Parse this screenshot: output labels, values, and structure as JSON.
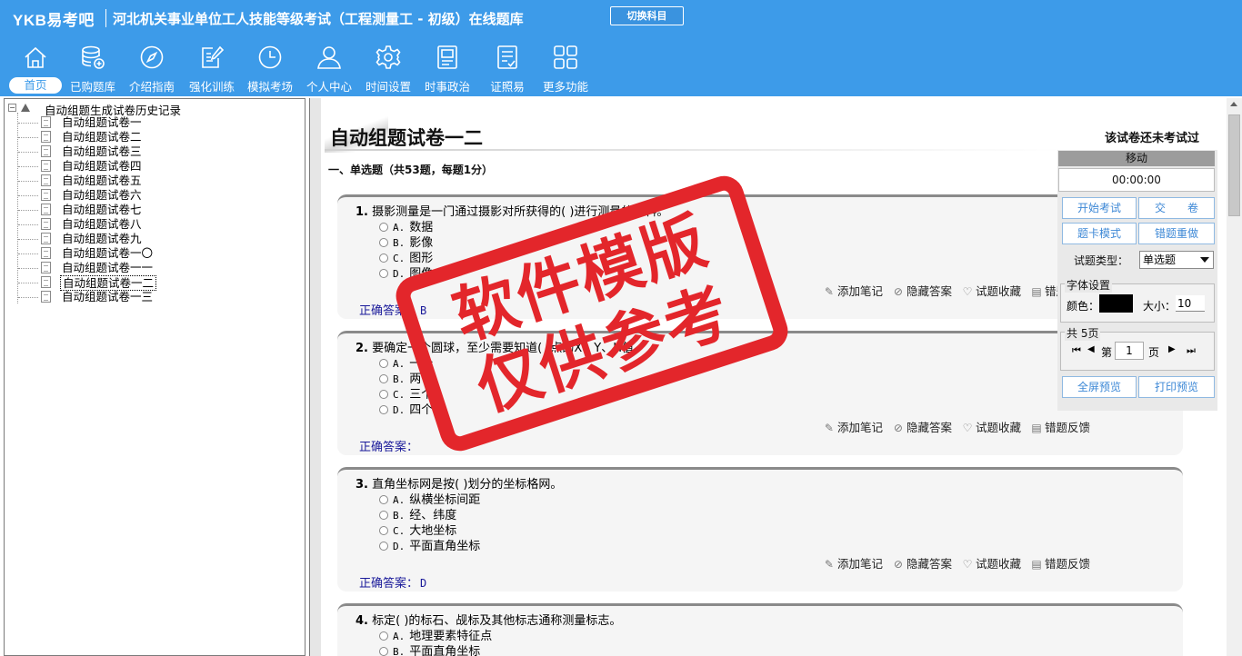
{
  "window": {
    "logo": "YKB易考吧",
    "title": "河北机关事业单位工人技能等级考试（工程测量工 - 初级）在线题库",
    "switch_button": "切换科目"
  },
  "nav": [
    {
      "label": "首页",
      "icon": "home-icon"
    },
    {
      "label": "已购题库",
      "icon": "database-icon"
    },
    {
      "label": "介绍指南",
      "icon": "compass-icon"
    },
    {
      "label": "强化训练",
      "icon": "edit-icon"
    },
    {
      "label": "模拟考场",
      "icon": "clock-icon"
    },
    {
      "label": "个人中心",
      "icon": "user-icon"
    },
    {
      "label": "时间设置",
      "icon": "gear-icon"
    },
    {
      "label": "时事政治",
      "icon": "book-icon"
    },
    {
      "label": "证照易",
      "icon": "checklist-icon"
    },
    {
      "label": "更多功能",
      "icon": "grid-icon"
    }
  ],
  "tree": {
    "root": "自动组题生成试卷历史记录",
    "items": [
      "自动组题试卷一",
      "自动组题试卷二",
      "自动组题试卷三",
      "自动组题试卷四",
      "自动组题试卷五",
      "自动组题试卷六",
      "自动组题试卷七",
      "自动组题试卷八",
      "自动组题试卷九",
      "自动组题试卷一〇",
      "自动组题试卷一一",
      "自动组题试卷一二",
      "自动组题试卷一三"
    ],
    "selected_index": 11
  },
  "paper": {
    "title": "自动组题试卷一二",
    "status": "该试卷还未考试过",
    "section_heading": "一、单选题（共53题，每题1分）"
  },
  "question_actions": {
    "add_note": "添加笔记",
    "hide_answer": "隐藏答案",
    "favorite": "试题收藏",
    "report_error": "错题反馈",
    "answer_label": "正确答案："
  },
  "questions": [
    {
      "number": "1.",
      "stem": "摄影测量是一门通过摄影对所获得的( )进行测量的学科。",
      "options": [
        {
          "key": "A.",
          "text": "数据"
        },
        {
          "key": "B.",
          "text": "影像"
        },
        {
          "key": "C.",
          "text": "图形"
        },
        {
          "key": "D.",
          "text": "图像"
        }
      ],
      "answer": "B"
    },
    {
      "number": "2.",
      "stem": "要确定一个圆球，至少需要知道( )点的X、Y、H值。",
      "options": [
        {
          "key": "A.",
          "text": "一个"
        },
        {
          "key": "B.",
          "text": "两个"
        },
        {
          "key": "C.",
          "text": "三个"
        },
        {
          "key": "D.",
          "text": "四个"
        }
      ],
      "answer": ""
    },
    {
      "number": "3.",
      "stem": "直角坐标网是按( )划分的坐标格网。",
      "options": [
        {
          "key": "A.",
          "text": "纵横坐标间距"
        },
        {
          "key": "B.",
          "text": "经、纬度"
        },
        {
          "key": "C.",
          "text": "大地坐标"
        },
        {
          "key": "D.",
          "text": "平面直角坐标"
        }
      ],
      "answer": "D"
    },
    {
      "number": "4.",
      "stem": "标定( )的标石、觇标及其他标志通称测量标志。",
      "options": [
        {
          "key": "A.",
          "text": "地理要素特征点"
        },
        {
          "key": "B.",
          "text": "平面直角坐标"
        }
      ],
      "answer": ""
    }
  ],
  "panel": {
    "move": "移动",
    "timer": "00:00:00",
    "start_exam": "开始考试",
    "submit": "交　　卷",
    "card_mode": "题卡模式",
    "wrong_redo": "错题重做",
    "type_label": "试题类型：",
    "type_value": "单选题",
    "font_legend": "字体设置",
    "color_label": "颜色：",
    "font_color": "#000000",
    "size_label": "大小：",
    "size_value": "10",
    "pages_legend": "共 5页",
    "page_prefix": "第",
    "page_value": "1",
    "page_suffix": "页",
    "fullscreen_preview": "全屏预览",
    "print_preview": "打印预览"
  },
  "watermark": {
    "line1": "软件模版",
    "line2": "仅供参考"
  },
  "colors": {
    "header_blue": "#3d9be9",
    "stamp_red": "#e3262b",
    "link_blue": "#3d88d6"
  }
}
